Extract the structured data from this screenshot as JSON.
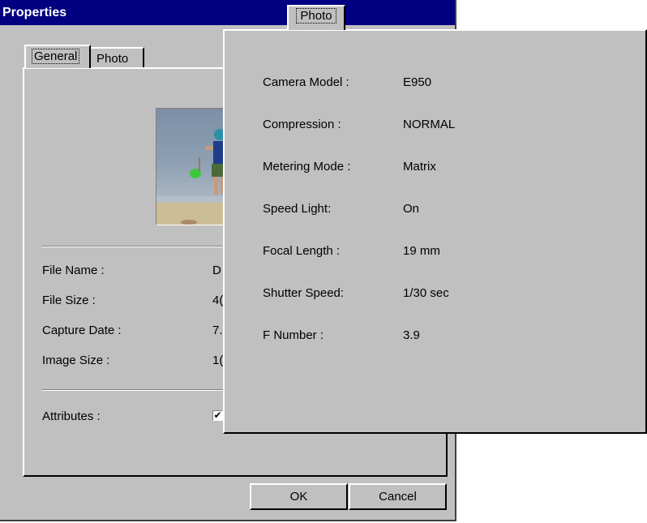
{
  "window": {
    "title": "Properties"
  },
  "tabs": [
    {
      "label": "General"
    },
    {
      "label": "Photo"
    }
  ],
  "general": {
    "fields": [
      {
        "label": "File Name :",
        "value": "D"
      },
      {
        "label": "File Size :",
        "value": "4("
      },
      {
        "label": "Capture Date :",
        "value": "7."
      },
      {
        "label": "Image Size :",
        "value": "1("
      }
    ],
    "attributes_label": "Attributes :",
    "attributes_checked": true,
    "checkbox_glyph": "✔"
  },
  "buttons": {
    "ok": "OK",
    "cancel": "Cancel"
  },
  "photo_popup": {
    "tab_label": "Photo",
    "rows": [
      {
        "label": "Camera Model :",
        "value": "E950"
      },
      {
        "label": "Compression :",
        "value": "NORMAL"
      },
      {
        "label": "Metering Mode :",
        "value": "Matrix"
      },
      {
        "label": "Speed Light:",
        "value": "On"
      },
      {
        "label": "Focal Length :",
        "value": "19 mm"
      },
      {
        "label": "Shutter Speed:",
        "value": "1/30 sec"
      },
      {
        "label": "F Number :",
        "value": "3.9"
      }
    ]
  },
  "colors": {
    "titlebar": "#000080",
    "face": "#c0c0c0"
  }
}
